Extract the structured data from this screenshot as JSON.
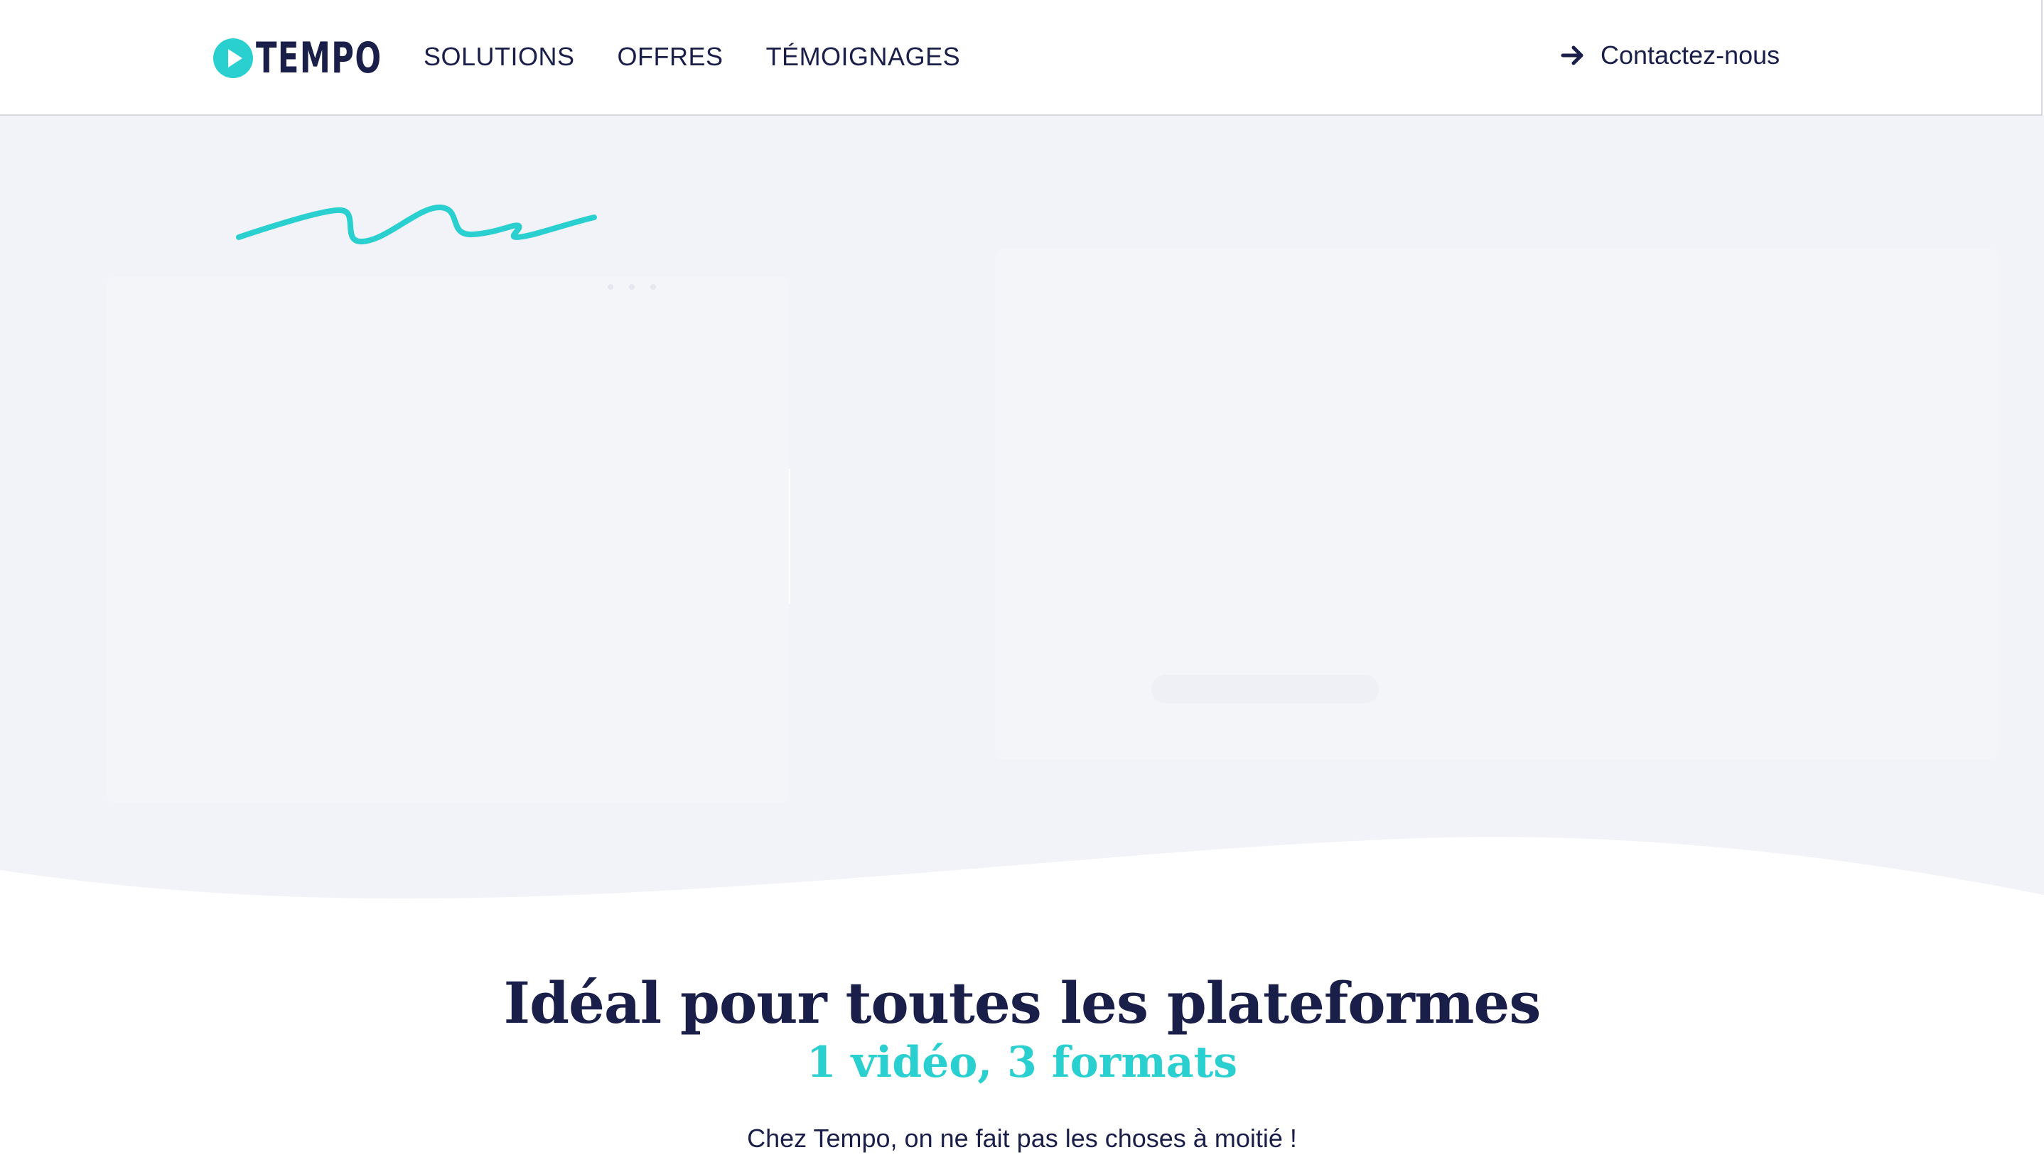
{
  "header": {
    "logo_text": "TEMPO",
    "nav": [
      {
        "label": "SOLUTIONS"
      },
      {
        "label": "OFFRES"
      },
      {
        "label": "TÉMOIGNAGES"
      }
    ],
    "contact_label": "Contactez-nous",
    "contact_icon": "arrow-right-icon"
  },
  "platforms": {
    "title": "Idéal pour toutes les plateformes",
    "subtitle": "1 vidéo, 3 formats",
    "text": "Chez Tempo, on ne fait pas les choses à moitié !"
  },
  "colors": {
    "navy": "#1a1f4a",
    "accent": "#2acfd0",
    "hero_bg": "#f2f3f8",
    "white": "#ffffff"
  }
}
